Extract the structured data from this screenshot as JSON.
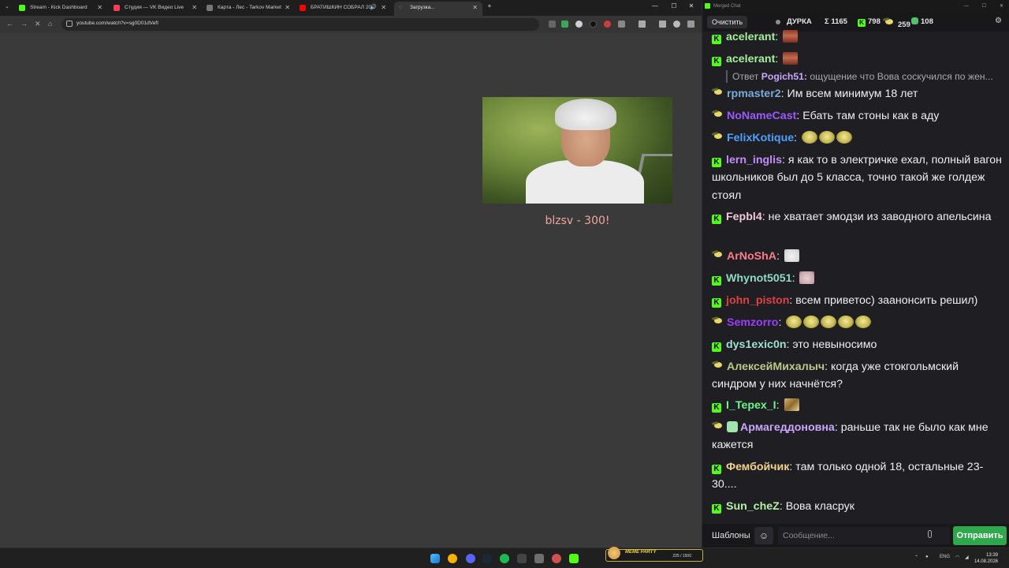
{
  "browser": {
    "tabs": [
      {
        "title": "Stream - Kick Dashboard",
        "color": "#53fc18"
      },
      {
        "title": "Студия — VK Видео Live",
        "color": "#ff3b5c"
      },
      {
        "title": "Карта - Лес - Tarkov Market",
        "color": "#777777"
      },
      {
        "title": "БРАТИШКИН СОБРАЛ 20",
        "color": "#ff0000"
      },
      {
        "title": "Загрузка...",
        "color": "#aaaaaa"
      }
    ],
    "url": "youtube.com/watch?v=sg0D01dVefI",
    "new_tab": "+",
    "window_controls": {
      "minimize": "—",
      "maximize": "☐",
      "close": "✕"
    }
  },
  "overlay": {
    "caption": "blzsv - 300!"
  },
  "chat": {
    "window_title": "Merged Chat",
    "clear_label": "Очистить",
    "stream_name": "ДУРКА",
    "stats": {
      "total": "Σ 1165",
      "kick": "798",
      "twitch": "259",
      "vk": "108"
    },
    "reply": {
      "prefix": "Ответ",
      "user": "Pogich51:",
      "text": " ощущение что Вова соскучился по жен..."
    },
    "messages": [
      {
        "platform": "kick",
        "user": "acelerant",
        "color": "#a4ef9c",
        "text": "",
        "emotes": [
          "lips"
        ]
      },
      {
        "platform": "kick",
        "user": "acelerant",
        "color": "#a4ef9c",
        "text": "",
        "emotes": [
          "lips"
        ]
      },
      {
        "platform": "twitch",
        "user": "rpmaster2",
        "color": "#7aa9d6",
        "text": "Им всем минимум 18 лет",
        "emotes": []
      },
      {
        "platform": "twitch",
        "user": "NoNameCast",
        "color": "#9b59ff",
        "text": "Ебать там стоны как в аду",
        "emotes": []
      },
      {
        "platform": "twitch",
        "user": "FelixKotique",
        "color": "#4ea0ff",
        "text": "",
        "emotes": [
          "frog",
          "frog",
          "frog"
        ]
      },
      {
        "platform": "kick",
        "user": "lern_inglis",
        "color": "#c58cff",
        "text": "я как то в электричке ехал, полный вагон школьников был до 5 класса, точно такой же голдеж стоял",
        "emotes": []
      },
      {
        "platform": "kick",
        "user": "Fepbl4",
        "color": "#f2c7d6",
        "text": "не хватает эмодзи из заводного апельсина",
        "emotes": []
      },
      {
        "platform": "twitch",
        "user": "ArNoShA",
        "color": "#ff7a8a",
        "text": "",
        "emotes": [
          "cat"
        ]
      },
      {
        "platform": "kick",
        "user": "Whynot5051",
        "color": "#8fd9c4",
        "text": "",
        "emotes": [
          "cat2"
        ]
      },
      {
        "platform": "kick",
        "user": "john_piston",
        "color": "#e04040",
        "text": "всем приветос) заанонсить решил)",
        "emotes": []
      },
      {
        "platform": "twitch",
        "user": "Semzorro",
        "color": "#9b3cff",
        "text": "",
        "emotes": [
          "frog",
          "frog",
          "frog",
          "frog",
          "frog"
        ]
      },
      {
        "platform": "kick",
        "user": "dys1exic0n",
        "color": "#9fe0d0",
        "text": "это невыносимо",
        "emotes": []
      },
      {
        "platform": "twitch",
        "user": "АлексейМихалыч",
        "color": "#b9c98c",
        "text": "когда уже стокгольмский синдром у них начнётся?",
        "emotes": []
      },
      {
        "platform": "kick",
        "user": "I_Tepex_I",
        "color": "#6cf58a",
        "text": "",
        "emotes": [
          "tiger"
        ]
      },
      {
        "platform": "twitch_mod",
        "user": "Армагеддоновна",
        "color": "#c9a6ff",
        "text": "раньше так не было как мне кажется",
        "emotes": []
      },
      {
        "platform": "kick",
        "user": "Фембойчик",
        "color": "#f2d28c",
        "text": "там только одной 18, остальные 23-30....",
        "emotes": []
      },
      {
        "platform": "kick",
        "user": "Sun_cheZ",
        "color": "#b6f0a8",
        "text": "Вова класрук",
        "emotes": []
      }
    ],
    "templates_label": "Шаблоны",
    "input_placeholder": "Сообщение...",
    "send_label": "Отправить"
  },
  "taskbar": {
    "lang": "ENG",
    "time": "13:39",
    "date": "14.08.2026",
    "meme_title": "MEME PARTY",
    "meme_count": "225 / 1500"
  }
}
